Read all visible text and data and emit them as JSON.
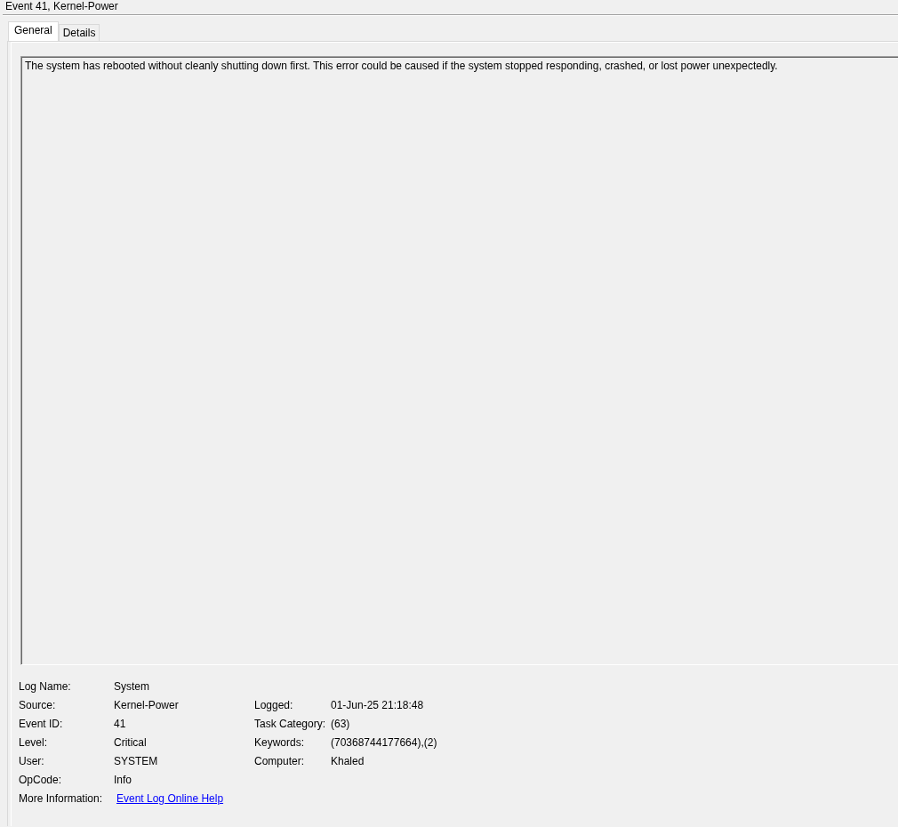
{
  "window": {
    "title": "Event 41, Kernel-Power"
  },
  "tabs": [
    {
      "label": "General",
      "selected": true
    },
    {
      "label": "Details",
      "selected": false
    }
  ],
  "description": "The system has rebooted without cleanly shutting down first. This error could be caused if the system stopped responding, crashed, or lost power unexpectedly.",
  "properties": [
    {
      "fields": [
        {
          "kind": "text",
          "label": "Log Name:",
          "value": "System"
        }
      ]
    },
    {
      "fields": [
        {
          "kind": "text",
          "label": "Source:",
          "value": "Kernel-Power"
        },
        {
          "kind": "text",
          "label": "Logged:",
          "value": "01-Jun-25 21:18:48"
        }
      ]
    },
    {
      "fields": [
        {
          "kind": "text",
          "label": "Event ID:",
          "value": "41"
        },
        {
          "kind": "text",
          "label": "Task Category:",
          "value": "(63)"
        }
      ]
    },
    {
      "fields": [
        {
          "kind": "text",
          "label": "Level:",
          "value": "Critical"
        },
        {
          "kind": "text",
          "label": "Keywords:",
          "value": "(70368744177664),(2)"
        }
      ]
    },
    {
      "fields": [
        {
          "kind": "text",
          "label": "User:",
          "value": "SYSTEM"
        },
        {
          "kind": "text",
          "label": "Computer:",
          "value": "Khaled"
        }
      ]
    },
    {
      "fields": [
        {
          "kind": "text",
          "label": "OpCode:",
          "value": "Info"
        }
      ]
    },
    {
      "fields": [
        {
          "kind": "link",
          "label": "More Information:",
          "value": "Event Log Online Help"
        }
      ]
    }
  ]
}
